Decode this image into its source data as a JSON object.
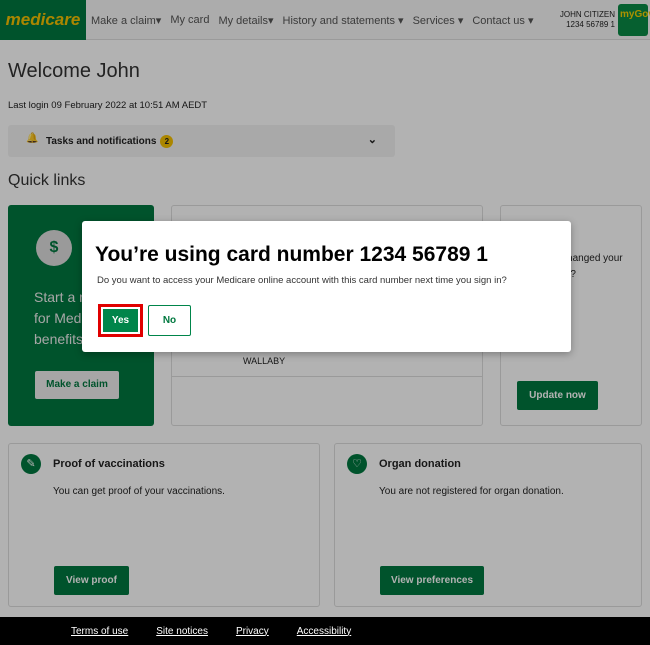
{
  "header": {
    "logo": "medicare",
    "nav": [
      "Make a claim▾",
      "My card",
      "My details▾",
      "History and statements ▾",
      "Services ▾",
      "Contact us ▾"
    ],
    "user_name": "JOHN CITIZEN",
    "card_number": "1234 56789 1",
    "mygov": "myGov"
  },
  "welcome": "Welcome John",
  "last_login": "Last login 09 February 2022 at 10:51 AM AEDT",
  "tasks": {
    "label": "Tasks and notifications",
    "count": "2"
  },
  "quick_links": "Quick links",
  "cards": {
    "claim": {
      "text": "Start a new claim for Medicare benefits.",
      "button": "Make a claim"
    },
    "card2": {
      "name": "WALLABY"
    },
    "bank": {
      "text": "Have you changed your bank details?",
      "button": "Update now"
    },
    "vacc": {
      "title": "Proof of vaccinations",
      "text": "You can get proof of your vaccinations.",
      "button": "View proof"
    },
    "organ": {
      "title": "Organ donation",
      "text": "You are not registered for organ donation.",
      "button": "View preferences"
    }
  },
  "footer": [
    "Terms of use",
    "Site notices",
    "Privacy",
    "Accessibility"
  ],
  "modal": {
    "title": "You’re using card number 1234 56789 1",
    "text": "Do you want to access your Medicare online account with this card number next time you sign in?",
    "yes": "Yes",
    "no": "No"
  }
}
